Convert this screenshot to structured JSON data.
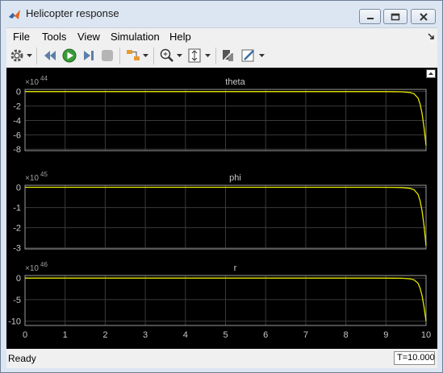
{
  "window": {
    "title": "Helicopter response",
    "accent_color": "#dce6f2"
  },
  "menu": {
    "items": [
      "File",
      "Tools",
      "View",
      "Simulation",
      "Help"
    ]
  },
  "toolbar": {
    "icons": [
      "gear-icon",
      "step-back-icon",
      "run-icon",
      "step-forward-icon",
      "stop-icon",
      "signal-selector-icon",
      "zoom-icon",
      "autoscale-icon",
      "highlight-icon",
      "style-icon"
    ]
  },
  "status": {
    "text": "Ready",
    "time": "T=10.000"
  },
  "chart_data": [
    {
      "type": "line",
      "title": "theta",
      "exponent_label": "×10",
      "exponent": "44",
      "x": [
        0,
        8.8,
        9.2,
        9.4,
        9.6,
        9.7,
        9.8,
        9.85,
        9.9,
        9.95,
        10.0
      ],
      "y": [
        0,
        0,
        -0.01,
        -0.03,
        -0.12,
        -0.3,
        -0.9,
        -1.7,
        -3.0,
        -5.0,
        -7.5
      ],
      "xlim": [
        0,
        10
      ],
      "ylim": [
        -8.2,
        0.3
      ],
      "yticks": [
        "0",
        "-2",
        "-4",
        "-6",
        "-8"
      ],
      "ytick_values": [
        0,
        -2,
        -4,
        -6,
        -8
      ],
      "line_color": "#e6e600",
      "grid": true
    },
    {
      "type": "line",
      "title": "phi",
      "exponent_label": "×10",
      "exponent": "45",
      "x": [
        0,
        8.8,
        9.2,
        9.4,
        9.6,
        9.7,
        9.8,
        9.85,
        9.9,
        9.95,
        10.0
      ],
      "y": [
        0,
        0,
        -0.004,
        -0.012,
        -0.05,
        -0.12,
        -0.35,
        -0.65,
        -1.15,
        -1.9,
        -2.9
      ],
      "xlim": [
        0,
        10
      ],
      "ylim": [
        -3.05,
        0.1
      ],
      "yticks": [
        "0",
        "-1",
        "-2",
        "-3"
      ],
      "ytick_values": [
        0,
        -1,
        -2,
        -3
      ],
      "line_color": "#e6e600",
      "grid": true
    },
    {
      "type": "line",
      "title": "r",
      "exponent_label": "×10",
      "exponent": "46",
      "x": [
        0,
        8.8,
        9.2,
        9.4,
        9.6,
        9.7,
        9.8,
        9.85,
        9.9,
        9.95,
        10.0
      ],
      "y": [
        0,
        0,
        -0.015,
        -0.045,
        -0.17,
        -0.4,
        -1.2,
        -2.3,
        -4.0,
        -6.7,
        -10.0
      ],
      "xlim": [
        0,
        10
      ],
      "ylim": [
        -11,
        0.6
      ],
      "yticks": [
        "0",
        "-5",
        "-10"
      ],
      "ytick_values": [
        0,
        -5,
        -10
      ],
      "xticks": [
        "0",
        "1",
        "2",
        "3",
        "4",
        "5",
        "6",
        "7",
        "8",
        "9",
        "10"
      ],
      "line_color": "#e6e600",
      "grid": true
    }
  ]
}
